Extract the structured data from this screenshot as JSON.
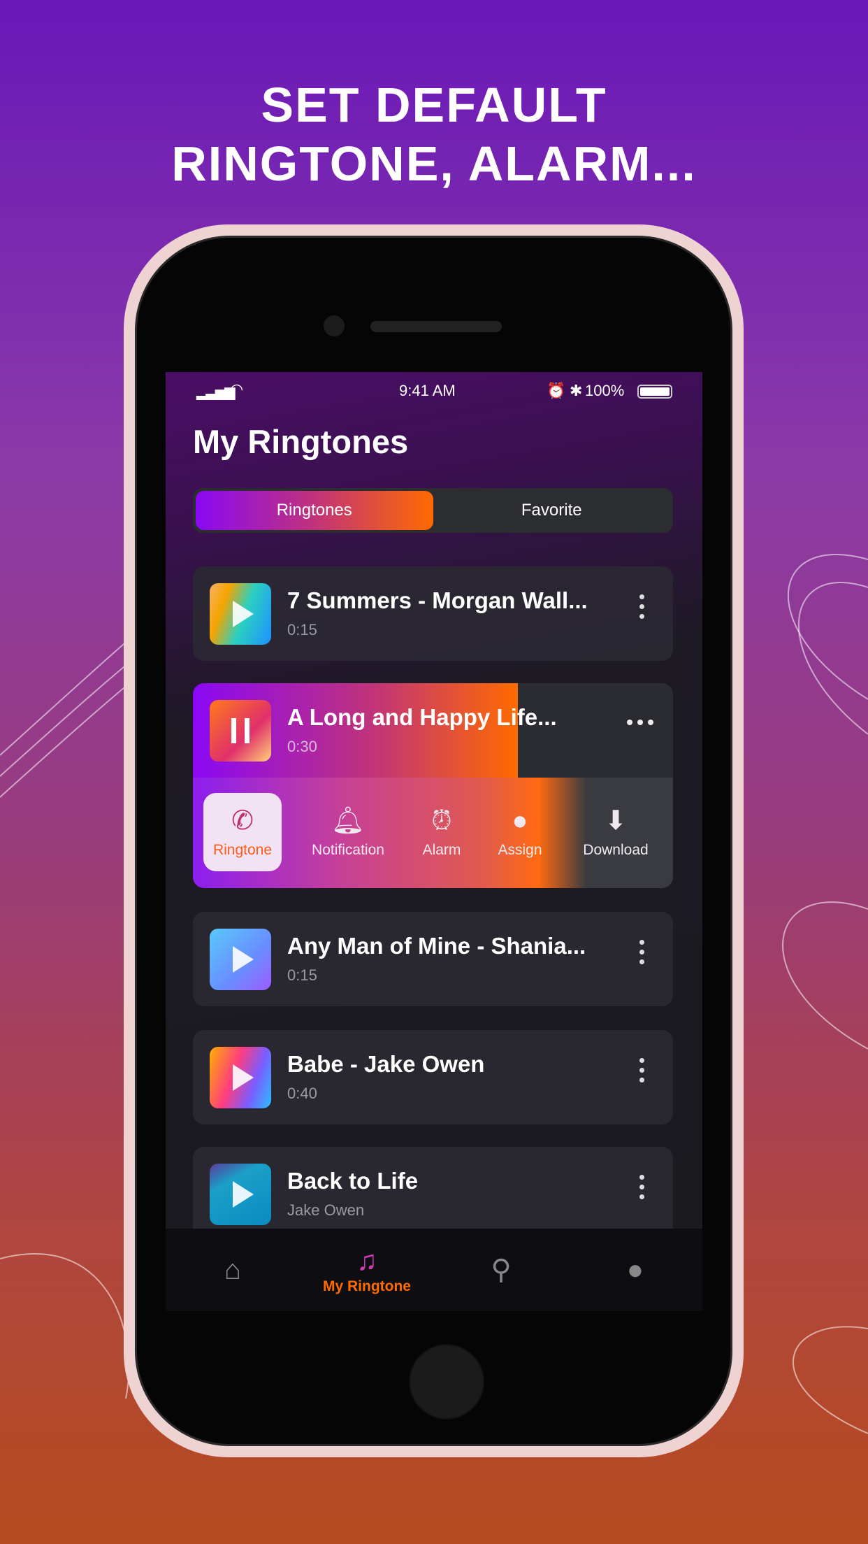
{
  "headline": {
    "line1": "SET DEFAULT",
    "line2": "RINGTONE, ALARM..."
  },
  "status_bar": {
    "time": "9:41 AM",
    "battery": "100%"
  },
  "page_title": "My Ringtones",
  "tabs": [
    {
      "label": "Ringtones",
      "active": true
    },
    {
      "label": "Favorite",
      "active": false
    }
  ],
  "ringtones": [
    {
      "title": "7 Summers - Morgan Wall...",
      "subtitle": "0:15"
    },
    {
      "title": "A Long and Happy Life...",
      "subtitle": "0:30",
      "playing": true
    },
    {
      "title": "Any Man of Mine - Shania...",
      "subtitle": "0:15"
    },
    {
      "title": "Babe - Jake Owen",
      "subtitle": "0:40"
    },
    {
      "title": "Back to Life",
      "subtitle": "Jake Owen"
    }
  ],
  "actions": [
    {
      "label": "Ringtone",
      "icon": "phone-icon",
      "selected": true
    },
    {
      "label": "Notification",
      "icon": "bell-icon"
    },
    {
      "label": "Alarm",
      "icon": "alarm-clock-icon"
    },
    {
      "label": "Assign",
      "icon": "person-icon"
    },
    {
      "label": "Download",
      "icon": "download-icon"
    }
  ],
  "bottom_nav": [
    {
      "icon": "home-icon"
    },
    {
      "icon": "music-note-icon",
      "label": "My Ringtone",
      "active": true
    },
    {
      "icon": "search-icon"
    },
    {
      "icon": "profile-icon"
    }
  ],
  "colors": {
    "accent_start": "#8a08f5",
    "accent_end": "#ff6a00",
    "active_tab_label": "#ff6a00"
  }
}
